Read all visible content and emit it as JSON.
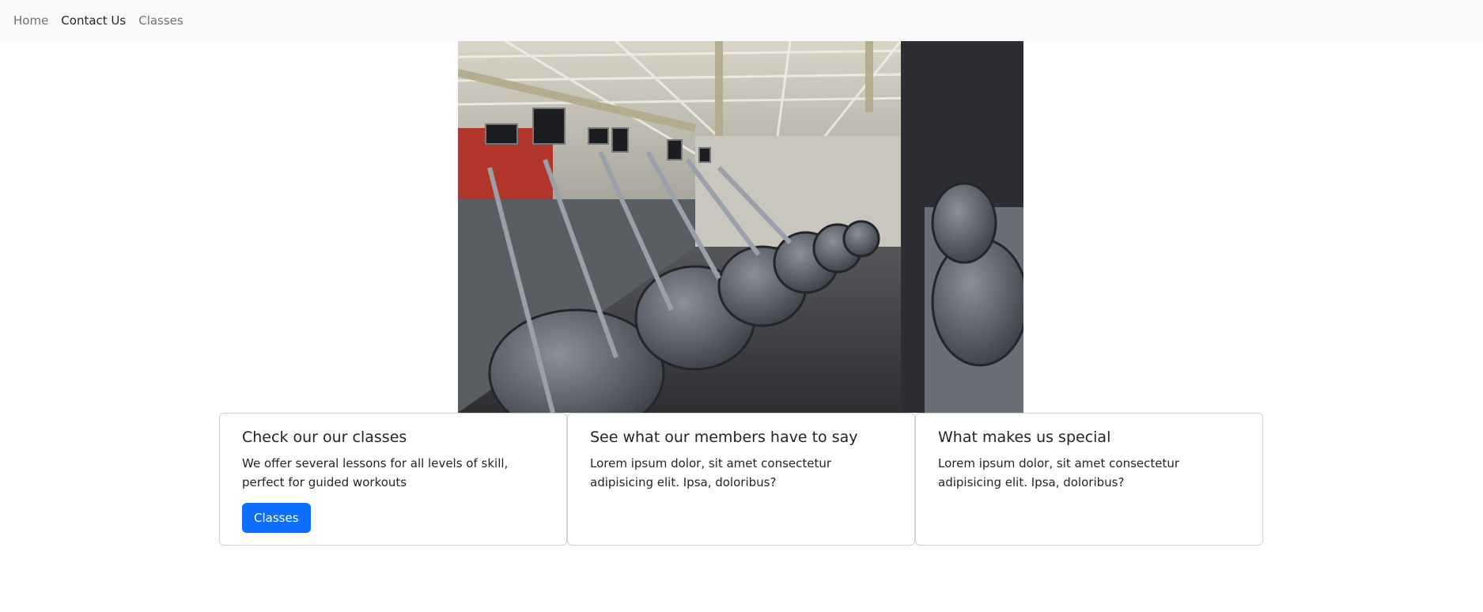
{
  "navbar": {
    "links": [
      {
        "label": "Home"
      },
      {
        "label": "Contact Us"
      },
      {
        "label": "Classes"
      }
    ]
  },
  "hero": {
    "image_icon": "gym-elliptical-machines-photo"
  },
  "cards": [
    {
      "title": "Check our our classes",
      "text": "We offer several lessons for all levels of skill, perfect for guided workouts",
      "button_label": "Classes"
    },
    {
      "title": "See what our members have to say",
      "text": "Lorem ipsum dolor, sit amet consectetur adipisicing elit. Ipsa, doloribus?"
    },
    {
      "title": "What makes us special",
      "text": "Lorem ipsum dolor, sit amet consectetur adipisicing elit. Ipsa, doloribus?"
    }
  ],
  "colors": {
    "navbar_bg": "#f8f9fa",
    "primary": "#0d6efd",
    "text": "#212529"
  }
}
